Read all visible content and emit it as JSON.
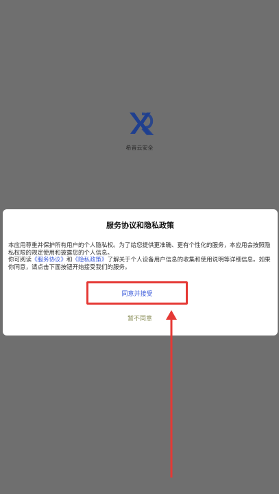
{
  "app": {
    "name": "希音云安全"
  },
  "dialog": {
    "title": "服务协议和隐私政策",
    "paragraph1": "本应用尊重并保护所有用户的个人隐私权。为了给您提供更准确、更有个性化的服务，本应用会按照隐私权限的规定使用和披露您的个人信息。",
    "p2_prefix": "你可阅读",
    "service_link": "《服务协议》",
    "p2_and": "和",
    "privacy_link": "《隐私政策》",
    "p2_suffix": "了解关于个人设备用户信息的收集和使用说明等详细信息。如果你同意，请点击下面按钮开始接受我们的服务。",
    "agree_label": "同意并接受",
    "disagree_label": "暂不同意"
  },
  "colors": {
    "overlay": "#6f6f6f",
    "link": "#3b5bdb",
    "highlight": "#e53935",
    "disagree_text": "#8b8f5a"
  },
  "icons": {
    "logo": "xr-logo-icon",
    "annotation": "red-arrow-icon"
  }
}
